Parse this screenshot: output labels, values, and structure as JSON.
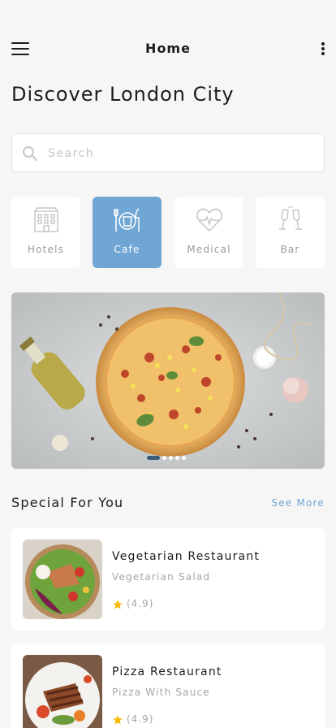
{
  "header": {
    "title": "Home",
    "menu_icon": "hamburger-menu-icon",
    "more_icon": "more-vertical-icon"
  },
  "headline": "Discover London City",
  "search": {
    "placeholder": "Search",
    "value": "",
    "icon": "search-icon"
  },
  "categories": [
    {
      "label": "Hotels",
      "icon": "hotel-building-icon",
      "active": false
    },
    {
      "label": "Cafe",
      "icon": "cafe-cup-icon",
      "active": true
    },
    {
      "label": "Medical",
      "icon": "heart-pulse-icon",
      "active": false
    },
    {
      "label": "Bar",
      "icon": "champagne-glasses-icon",
      "active": false
    }
  ],
  "banner": {
    "image": "pizza-photo",
    "slide_count": 5,
    "active_slide": 1
  },
  "special": {
    "title": "Special For You",
    "see_more": "See More"
  },
  "restaurants": [
    {
      "name": "Vegetarian Restaurant",
      "subtitle": "Vegetarian Salad",
      "rating": "(4.9)",
      "image": "salad-bowl-photo"
    },
    {
      "name": "Pizza Restaurant",
      "subtitle": "Pizza With Sauce",
      "rating": "(4.9)",
      "image": "grilled-plate-photo"
    }
  ],
  "colors": {
    "accent": "#6fa6d3",
    "background": "#f6f6f6",
    "star": "#f5b800",
    "dot_active": "#3b5b7a"
  }
}
